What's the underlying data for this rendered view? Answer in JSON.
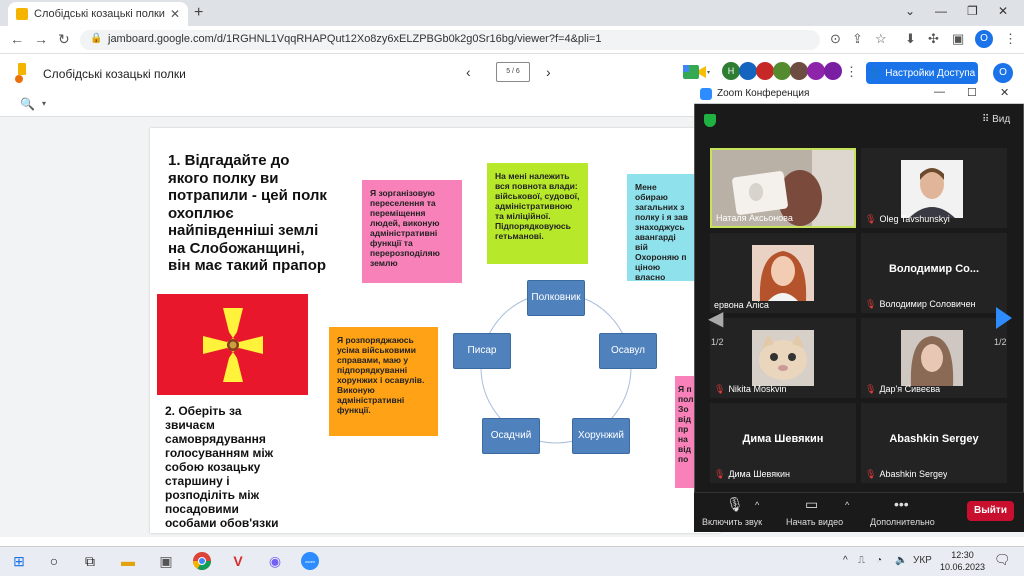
{
  "browser": {
    "tab_title": "Слобідські козацькі полки - Goo",
    "tab_close": "✕",
    "new_tab": "+",
    "url": "jamboard.google.com/d/1RGHNL1VqqRHAPQut12Xo8zy6xELZPBGb0k2g0Sr16bg/viewer?f=4&pli=1",
    "profile_letter": "О"
  },
  "jamboard": {
    "title": "Слобідські козацькі полки",
    "frame_indicator": "5 / 6",
    "share_button": "Настройки Доступа",
    "profile_letter": "О",
    "collaborators": [
      {
        "letter": "Н",
        "color": "#2e7d32"
      },
      {
        "letter": "",
        "color": "#1565c0"
      },
      {
        "letter": "",
        "color": "#c62828"
      },
      {
        "letter": "",
        "color": "#558b2f"
      },
      {
        "letter": "",
        "color": "#6d4c41"
      },
      {
        "letter": "",
        "color": "#8e24aa"
      },
      {
        "letter": "",
        "color": "#7b1fa2"
      }
    ]
  },
  "board": {
    "question1": "1. Відгадайте до якого полку ви потрапили - цей полк охоплює найпівденніші землі на Слобожанщині, він має такий прапор",
    "question2": "2. Оберіть за звичаєм самоврядування голосуванням між собою козацьку старшину і розподіліть між посадовими особами обов'язки",
    "notes": {
      "pink": "Я зорганізовую переселення та переміщення людей, виконую адміністративні функції та перерозподіляю землю",
      "green": "На мені належить вся повнота влади: військової, судової, адміністративною та міліційної. Підпорядковуюсь гетьманові.",
      "cyan": "Мене обираю загальних з полку і я зав знаходжусь авангарді вій Охороняю п ціною власно життя.",
      "orange": "Я розпоряджаюсь усіма військовими справами, маю у підпорядкуванні хорунжих і осавулів. Виконую адміністративні функції.",
      "pink2": "Я п пол Зо від пр на від по"
    },
    "ranks": [
      "Полковник",
      "Осавул",
      "Хорунжий",
      "Осадчий",
      "Писар"
    ]
  },
  "zoom": {
    "title": "Zoom Конференция",
    "view_label": "Вид",
    "participants": [
      {
        "name": "Наталя Аксьонова",
        "big": "",
        "muted": false
      },
      {
        "name": "Oleg Tavshunskyi",
        "big": "",
        "muted": true
      },
      {
        "name": "ервона Аліса",
        "big": "",
        "muted": false
      },
      {
        "name": "Володимир Соловичен",
        "big": "Володимир Со...",
        "muted": true
      },
      {
        "name": "Nikita Moskvin",
        "big": "",
        "muted": true
      },
      {
        "name": "Дар'я Сивеєва",
        "big": "",
        "muted": true
      },
      {
        "name": "Дима Шевякин",
        "big": "Дима Шевякин",
        "muted": true
      },
      {
        "name": "Abashkin Sergey",
        "big": "Abashkin Sergey",
        "muted": true
      }
    ],
    "page_left": "1/2",
    "page_right": "1/2",
    "controls": {
      "unmute": "Включить звук",
      "start_video": "Начать видео",
      "more": "Дополнительно",
      "leave": "Выйти"
    }
  },
  "taskbar": {
    "language": "УКР",
    "time": "12:30",
    "date": "10.06.2023"
  }
}
